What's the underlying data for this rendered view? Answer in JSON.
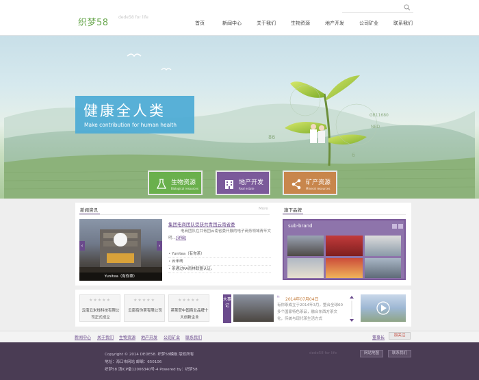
{
  "header": {
    "logo": "织梦58",
    "logo_tagline": "dede58 for life",
    "nav": [
      "首页",
      "新闻中心",
      "关于我们",
      "生物资源",
      "地产开发",
      "公司矿业",
      "联系我们"
    ]
  },
  "banner": {
    "title": "健康全人类",
    "subtitle": "Make contribution for human health",
    "labels": [
      "GB11680",
      "NBD",
      "86",
      "6"
    ],
    "categories": [
      {
        "label": "生物资源",
        "sub": "Biological resources",
        "icon": "flask-icon",
        "color": "#6ab04c"
      },
      {
        "label": "地产开发",
        "sub": "Real estate",
        "icon": "building-icon",
        "color": "#7b5a9a"
      },
      {
        "label": "矿产资源",
        "sub": "Mineral resources",
        "icon": "share-icon",
        "color": "#c8864c"
      }
    ]
  },
  "news": {
    "title": "新闻资讯",
    "more": "More",
    "photo_caption": "Yunitea（有你茶）",
    "headline": "集团电商团队受获共青团云南省委",
    "summary": "电商团队在共青团云南省委开展的电子商务领域青年文明...",
    "summary_more": "[详细]",
    "list": [
      "Yunitea（有你茶）",
      "云米线",
      "茶通过RA雨林联盟认证。"
    ]
  },
  "brand": {
    "title": "旗下品牌",
    "box_title": "sub-brand"
  },
  "partners": [
    {
      "stars": "★★★★★",
      "text": "云南云米线科技有限公司正式成立"
    },
    {
      "stars": "★★★★★",
      "text": "云南有你茶有限公司"
    },
    {
      "stars": "★★★★★",
      "text": "英茶获中国商业品牌十大创新企业"
    }
  ],
  "events": {
    "tag": "大事记",
    "date": "2014年07月04日",
    "text": "有你茶成立于2014年3月，整合全球60多个国家特色茶品，融合东西方茶文化，传统与现代茶生活方式"
  },
  "footer_links": [
    "新闻中心",
    "关于我们",
    "生物资源",
    "地产开发",
    "公司矿业",
    "联系我们"
  ],
  "share": {
    "label": "董事长",
    "follow": "加关注"
  },
  "footer": {
    "copyright": "Copyright © 2014 DEDE58. 织梦58模板 版权所有",
    "address": "地址：海口市网站 邮编：650106",
    "icp": "织梦58 滇ICP备12006340号-4    Powered by：织梦58",
    "brand_text": "dede58 for life",
    "btn_map": "网站地图",
    "btn_contact": "联系我们"
  },
  "colors": {
    "accent": "#6a4a8c",
    "green": "#6ab04c",
    "orange": "#c8864c",
    "banner_blue": "#4caad5"
  }
}
